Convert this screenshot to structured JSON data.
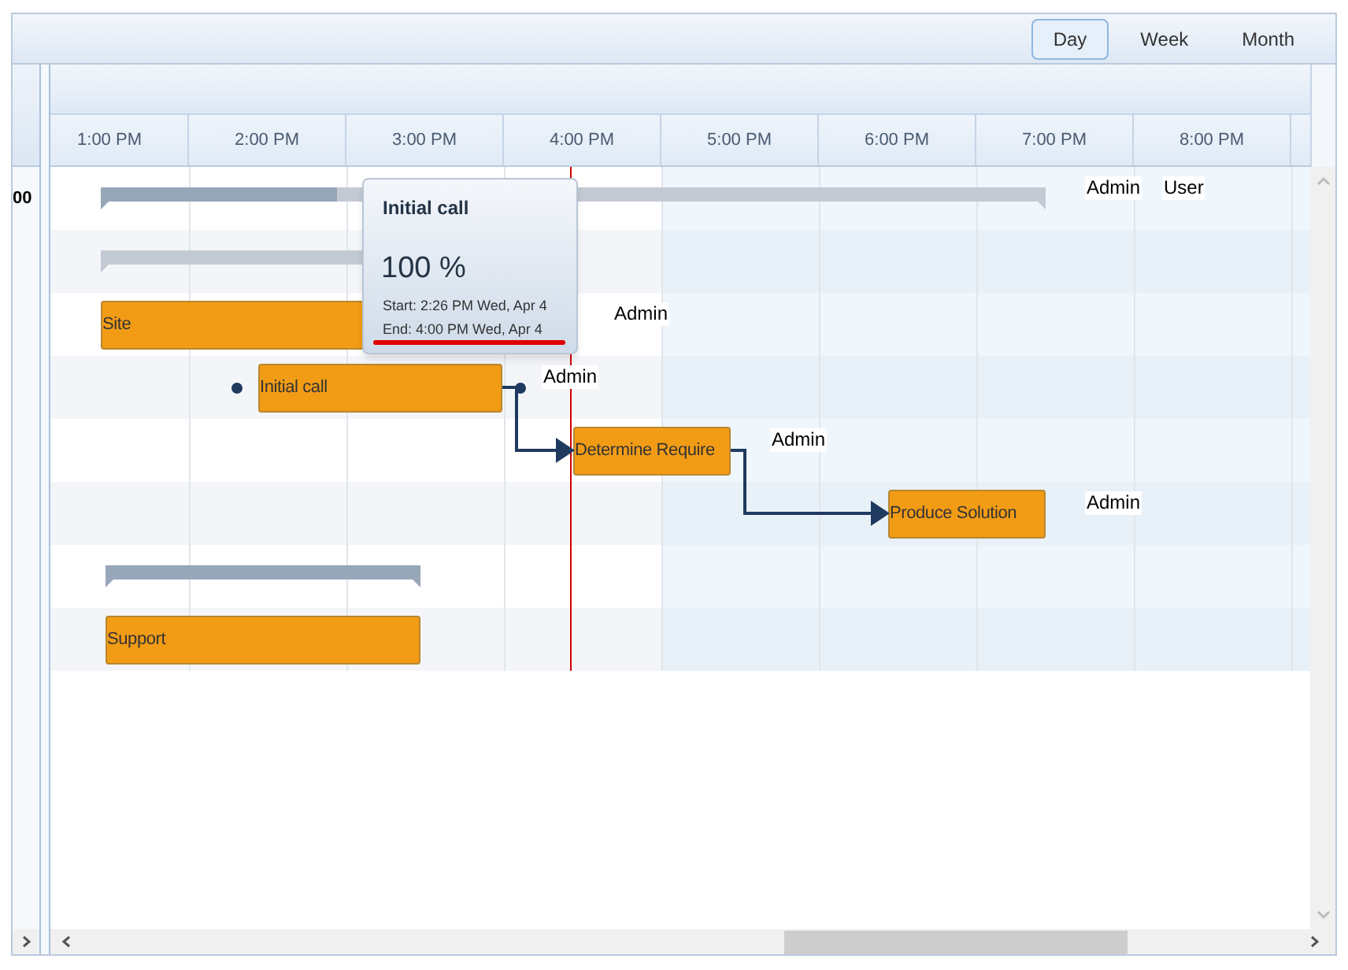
{
  "view_switcher": [
    {
      "label": "Day",
      "selected": true
    },
    {
      "label": "Week",
      "selected": false
    },
    {
      "label": "Month",
      "selected": false
    }
  ],
  "grid_cell": "00",
  "hours": [
    "1:00 PM",
    "2:00 PM",
    "3:00 PM",
    "4:00 PM",
    "5:00 PM",
    "6:00 PM",
    "7:00 PM",
    "8:00 PM"
  ],
  "tasks": [
    {
      "kind": "summary",
      "level": 0.25,
      "resources": [
        "Admin",
        "User"
      ]
    },
    {
      "kind": "summary",
      "level": 0
    },
    {
      "kind": "task",
      "title": "Site",
      "resources": [
        "Admin"
      ]
    },
    {
      "kind": "task",
      "title": "Initial call",
      "resources": [
        "Admin"
      ],
      "handles": true,
      "linked_to_next": true
    },
    {
      "kind": "task",
      "title": "Determine Require",
      "resources": [
        "Admin"
      ],
      "linked_to_next": true
    },
    {
      "kind": "task",
      "title": "Produce Solution",
      "resources": [
        "Admin"
      ]
    },
    {
      "kind": "summary",
      "level": 1
    },
    {
      "kind": "task",
      "title": "Support"
    }
  ],
  "tooltip": {
    "title": "Initial call",
    "progress": "100 %",
    "start": "Start: 2:26 PM Wed, Apr 4",
    "end": "End: 4:00 PM Wed, Apr 4",
    "underlined": true
  }
}
